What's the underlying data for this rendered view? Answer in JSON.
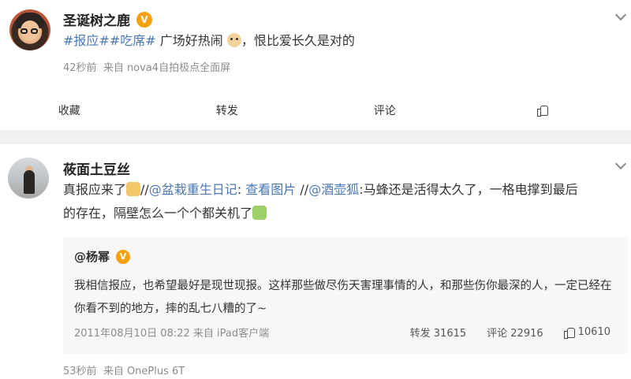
{
  "post1": {
    "username": "圣诞树之鹿",
    "vip_badge": "V",
    "topics": [
      "#报应#",
      "#吃席#"
    ],
    "text_middle": " 广场好热闹",
    "text_end": "，恨比爱长久是对的",
    "time": "42秒前",
    "source": "来自 nova4自拍极点全面屏",
    "actions": {
      "favorite": "收藏",
      "repost": "转发",
      "comment": "评论"
    }
  },
  "post2": {
    "username": "莜面土豆丝",
    "line1_a": "真报应来了",
    "line1_b": "//",
    "mention1": "@盆栽重生日记",
    "colon1": ": ",
    "view_image": "查看图片",
    "line1_c": " //",
    "mention2": "@酒壶狐",
    "line1_d": ":马蜂还是活得太久了，一格电撑到最后",
    "line2": "的存在，隔壁怎么一个个都关机了",
    "time": "53秒前",
    "source": "来自 OnePlus 6T",
    "quote": {
      "username": "@杨幂",
      "vip_badge": "V",
      "text": "我相信报应，也希望最好是现世现报。这样那些做尽伤天害理事情的人，和那些伤你最深的人，一定已经在你看不到的地方，摔的乱七八糟的了~",
      "meta": "2011年08月10日 08:22 来自 iPad客户端",
      "repost": "转发 31615",
      "comment": "评论 22916",
      "likes": "10610"
    }
  },
  "colors": {
    "link": "#4a78b6",
    "vip": "#f5a20e",
    "meta": "#8c8c8c"
  }
}
